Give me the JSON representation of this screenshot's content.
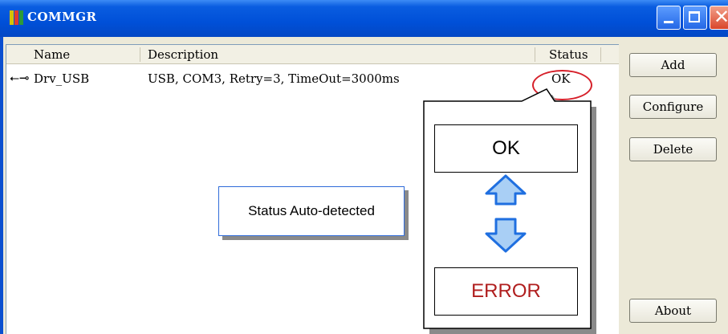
{
  "window": {
    "title": "COMMGR",
    "icon": "app-icon",
    "controls": [
      "minimize-icon",
      "maximize-icon",
      "close-icon"
    ]
  },
  "list": {
    "columns": [
      "Name",
      "Description",
      "Status"
    ],
    "rows": [
      {
        "icon": "usb-icon",
        "name": "Drv_USB",
        "description": "USB, COM3, Retry=3, TimeOut=3000ms",
        "status": "OK"
      }
    ]
  },
  "buttons": {
    "add": "Add",
    "configure": "Configure",
    "delete": "Delete",
    "about": "About"
  },
  "annotation": {
    "callout": "Status Auto-detected",
    "status_ok": "OK",
    "status_error": "ERROR",
    "arrow_up": "arrow-up-icon",
    "arrow_down": "arrow-down-icon"
  },
  "colors": {
    "titlebar": "#0050d8",
    "highlight_circle": "#d6202a",
    "error_text": "#b01e1e",
    "arrow_fill": "#a9cff5",
    "arrow_stroke": "#1f6fe0"
  }
}
